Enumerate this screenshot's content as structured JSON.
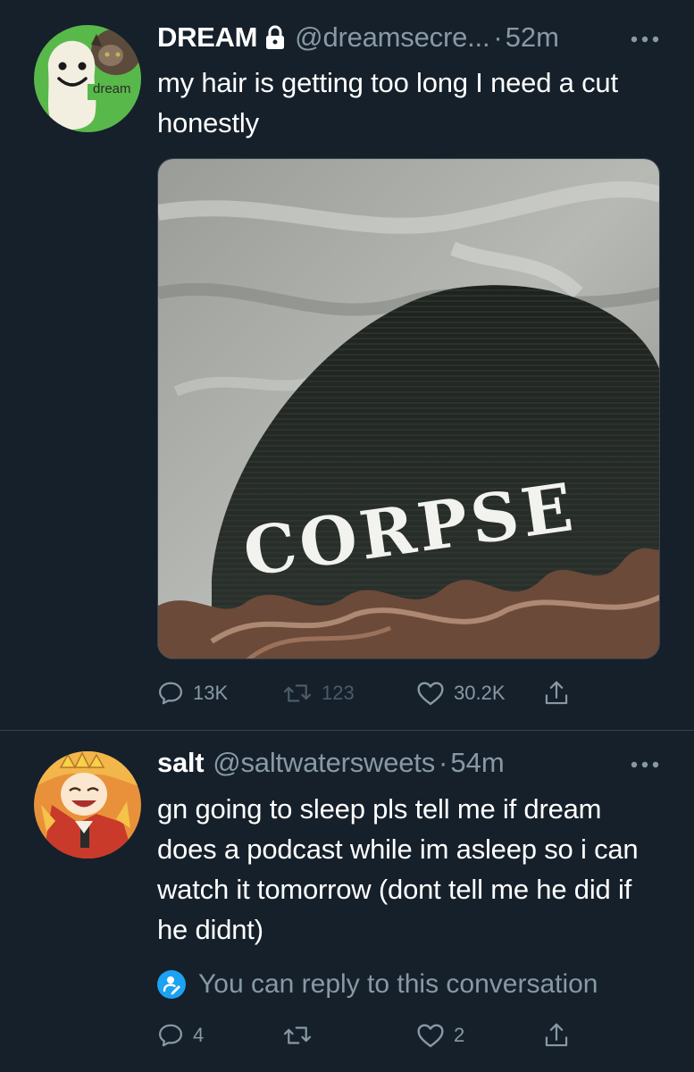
{
  "tweets": [
    {
      "display_name": "DREAM",
      "protected": true,
      "handle": "@dreamsecre...",
      "separator": "·",
      "time": "52m",
      "text": "my hair is getting too long I need a cut honestly",
      "avatar_label": "dream",
      "media_text": "CORPSE",
      "actions": {
        "replies": "13K",
        "retweets": "123",
        "likes": "30.2K"
      }
    },
    {
      "display_name": "salt",
      "handle": "@saltwatersweets",
      "separator": "·",
      "time": "54m",
      "text": "gn going to sleep pls tell me if dream does a podcast while im asleep so i can watch it tomorrow (dont tell me he did if he didnt)",
      "reply_note": "You can reply to this conversation",
      "actions": {
        "replies": "4",
        "likes": "2"
      }
    }
  ],
  "colors": {
    "background": "#15202b",
    "secondary_text": "#8899a6",
    "divider": "#38444d",
    "accent": "#1da1f2"
  },
  "icons": [
    "lock-icon",
    "more-icon",
    "reply-icon",
    "retweet-icon",
    "like-icon",
    "share-icon",
    "reply-permission-icon"
  ]
}
